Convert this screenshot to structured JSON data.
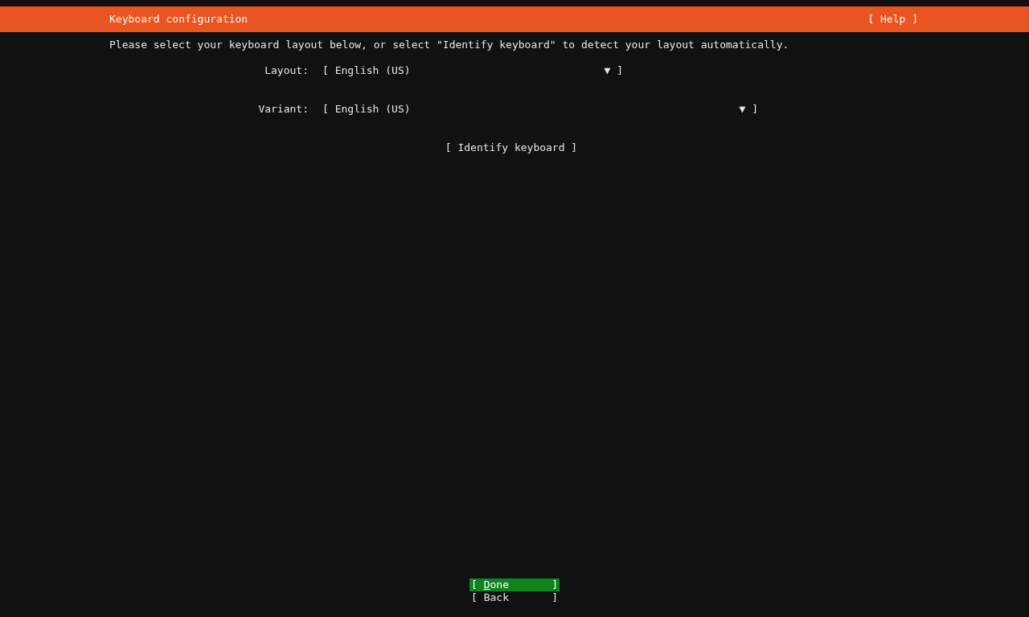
{
  "header": {
    "title": "Keyboard configuration",
    "help": "[ Help ]"
  },
  "instructions": "Please select your keyboard layout below, or select \"Identify keyboard\" to detect your layout automatically.",
  "fields": [
    {
      "label": "Layout:",
      "open_bracket": "[",
      "value": "English (US)",
      "arrow": "▼",
      "close_bracket": "]"
    },
    {
      "label": "Variant:",
      "open_bracket": "[",
      "value": "English (US)",
      "arrow": "▼",
      "close_bracket": "]"
    }
  ],
  "identify_button": "[ Identify keyboard ]",
  "actions": [
    {
      "open_bracket": "[",
      "label": "Done",
      "close_bracket": "]",
      "underline_first": true,
      "selected": true
    },
    {
      "open_bracket": "[",
      "label": "Back",
      "close_bracket": "]",
      "underline_first": false,
      "selected": false
    }
  ]
}
